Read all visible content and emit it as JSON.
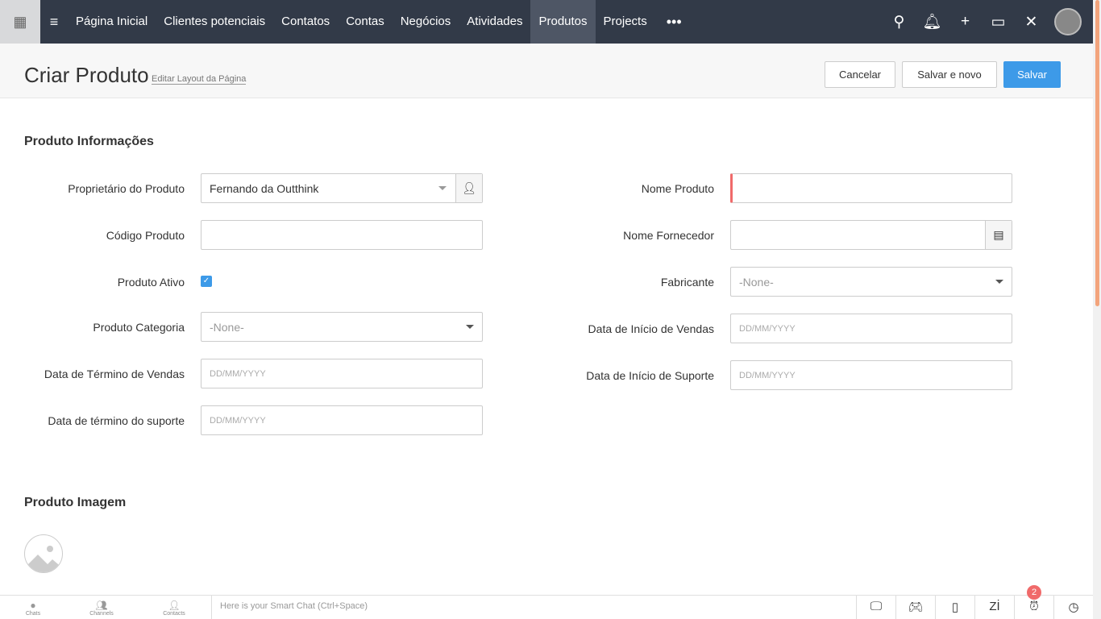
{
  "nav": {
    "tabs": [
      "Página Inicial",
      "Clientes potenciais",
      "Contatos",
      "Contas",
      "Negócios",
      "Atividades",
      "Produtos",
      "Projects"
    ],
    "active": "Produtos",
    "more": "•••"
  },
  "header": {
    "title": "Criar Produto",
    "edit_layout": "Editar Layout da Página",
    "cancel": "Cancelar",
    "save_new": "Salvar e novo",
    "save": "Salvar"
  },
  "section1": {
    "title": "Produto Informações",
    "owner_label": "Proprietário do Produto",
    "owner_value": "Fernando da Outthink",
    "code_label": "Código Produto",
    "active_label": "Produto Ativo",
    "category_label": "Produto Categoria",
    "category_value": "-None-",
    "sales_end_label": "Data de Término de Vendas",
    "support_end_label": "Data de término do suporte",
    "name_label": "Nome Produto",
    "vendor_label": "Nome Fornecedor",
    "manufacturer_label": "Fabricante",
    "manufacturer_value": "-None-",
    "sales_start_label": "Data de Início de Vendas",
    "support_start_label": "Data de Início de Suporte",
    "date_placeholder": "DD/MM/YYYY"
  },
  "section2": {
    "title": "Produto Imagem"
  },
  "footer": {
    "chats": "Chats",
    "channels": "Channels",
    "contacts": "Contacts",
    "smart_chat": "Here is your Smart Chat (Ctrl+Space)",
    "badge": "2"
  },
  "colors": {
    "nav": "#323a48",
    "accent": "#3d9ae8",
    "required": "#f06a6a"
  }
}
